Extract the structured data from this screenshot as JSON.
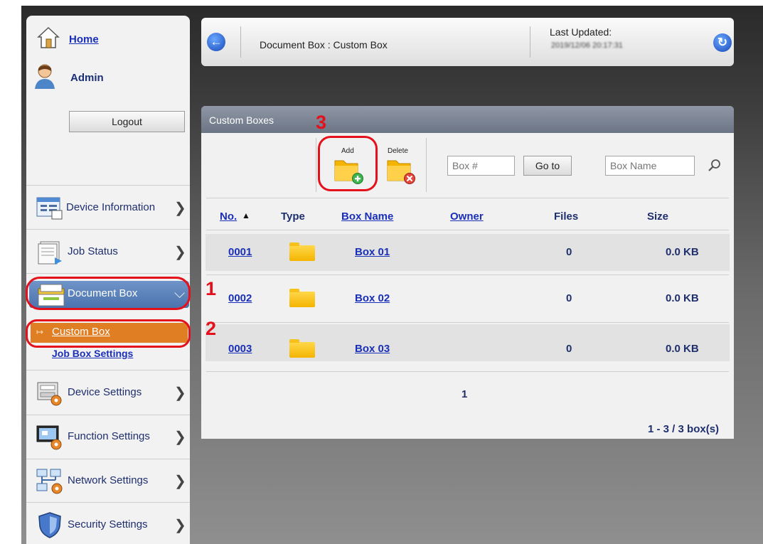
{
  "sidebar": {
    "home": "Home",
    "user": "Admin",
    "logout": "Logout",
    "menu": {
      "device_info": "Device Information",
      "job_status": "Job Status",
      "document_box": "Document Box",
      "custom_box": "Custom Box",
      "job_box_settings": "Job Box Settings",
      "device_settings": "Device Settings",
      "function_settings": "Function Settings",
      "network_settings": "Network Settings",
      "security_settings": "Security Settings"
    }
  },
  "header": {
    "breadcrumb": "Document Box : Custom Box",
    "last_updated_label": "Last Updated:",
    "last_updated_value": "2019/12/06 20:17:31"
  },
  "panel": {
    "title": "Custom Boxes",
    "add_label": "Add",
    "delete_label": "Delete",
    "box_number_placeholder": "Box #",
    "goto_label": "Go to",
    "box_name_placeholder": "Box Name",
    "columns": [
      "No.",
      "Type",
      "Box Name",
      "Owner",
      "Files",
      "Size"
    ],
    "rows": [
      {
        "no": "0001",
        "name": "Box 01",
        "owner": "",
        "files": "0",
        "size": "0.0 KB"
      },
      {
        "no": "0002",
        "name": "Box 02",
        "owner": "",
        "files": "0",
        "size": "0.0 KB"
      },
      {
        "no": "0003",
        "name": "Box 03",
        "owner": "",
        "files": "0",
        "size": "0.0 KB"
      }
    ],
    "page": "1",
    "count": "1 - 3 / 3 box(s)"
  },
  "annotations": {
    "step1": "1",
    "step2": "2",
    "step3": "3"
  },
  "colors": {
    "accent_red": "#e4111c",
    "active_orange": "#e07e24",
    "active_blue": "#5b82bb",
    "link_blue": "#1a2fb8"
  }
}
